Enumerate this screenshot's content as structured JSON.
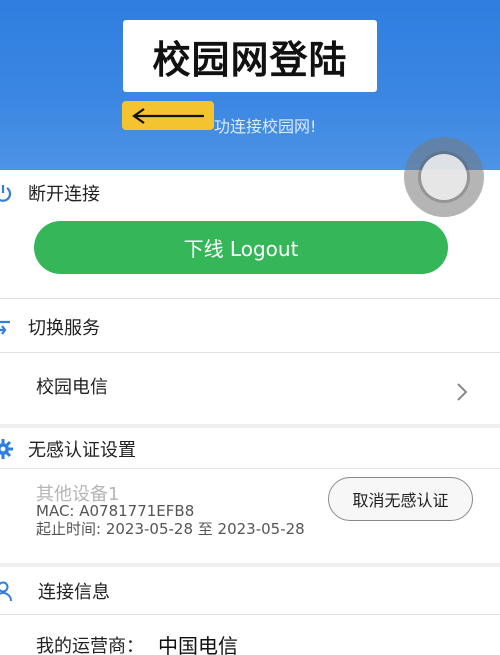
{
  "header": {
    "title": "校园网登陆",
    "subtitle": "功连接校园网!",
    "back_icon": "left-arrow-icon",
    "accent_color": "#2f7ee0"
  },
  "disconnect": {
    "heading": "断开连接",
    "icon": "power-icon",
    "logout_label": "下线 Logout",
    "button_color": "#34b659"
  },
  "service": {
    "heading": "切换服务",
    "icon": "switch-icon",
    "current": "校园电信"
  },
  "noauth": {
    "heading": "无感认证设置",
    "icon": "gear-icon",
    "device_name": "其他设备1",
    "mac": "MAC: A0781771EFB8",
    "time": "起止时间: 2023-05-28 至 2023-05-28",
    "cancel_label": "取消无感认证"
  },
  "connection": {
    "heading": "连接信息",
    "icon": "user-icon",
    "operator_label": "我的运营商：",
    "operator_value": "中国电信"
  }
}
